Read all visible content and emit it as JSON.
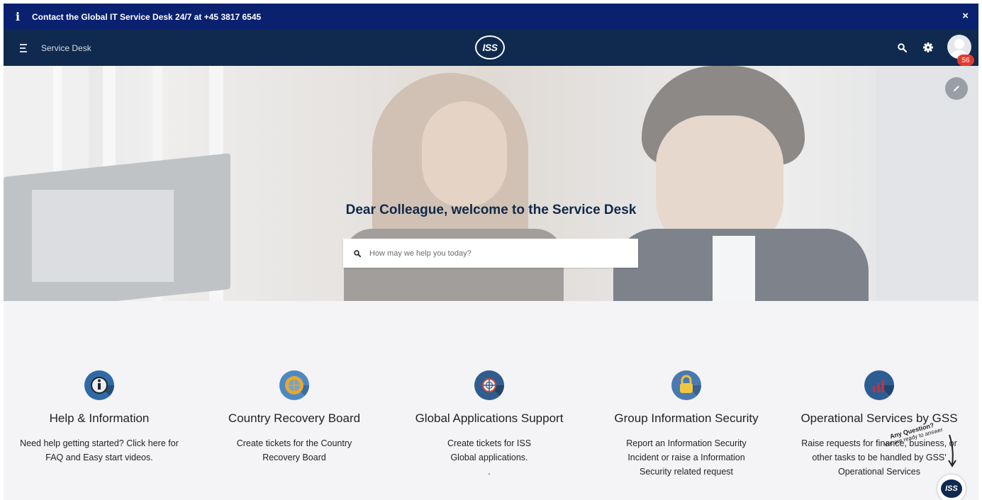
{
  "banner": {
    "icon": "info-icon",
    "message": "Contact the Global IT Service Desk 24/7 at +45 3817 6545",
    "close_glyph": "×"
  },
  "header": {
    "brand": "Service Desk",
    "logo_text": "ISS",
    "notifications_count": "56"
  },
  "hero": {
    "title": "Dear Colleague, welcome to the Service Desk",
    "search_placeholder": "How may we help you today?"
  },
  "cards": [
    {
      "title": "Help & Information",
      "description": "Need help getting started? Click here for FAQ and Easy start videos.",
      "icon": "info-icon"
    },
    {
      "title": "Country Recovery Board",
      "description": "Create tickets for the Country Recovery Board",
      "icon": "globe-gear-icon"
    },
    {
      "title": "Global Applications Support",
      "description": "Create tickets for ISS Global applications.",
      "extra": ".",
      "icon": "globe-icon"
    },
    {
      "title": "Group Information Security",
      "description": "Report an Information Security Incident or raise a Information Security related request",
      "icon": "lock-icon"
    },
    {
      "title": "Operational Services by GSS",
      "description": "Raise requests for finance, business, or other tasks to be handled by GSS' Operational Services",
      "icon": "bar-chart-icon"
    }
  ],
  "chat": {
    "hint_title": "Any Question?",
    "hint_sub": "We are ready to answer",
    "logo_text": "ISS"
  },
  "colors": {
    "banner_bg": "#0a2170",
    "header_bg": "#0f2a4e",
    "badge": "#e23a30",
    "title": "#10294a"
  }
}
